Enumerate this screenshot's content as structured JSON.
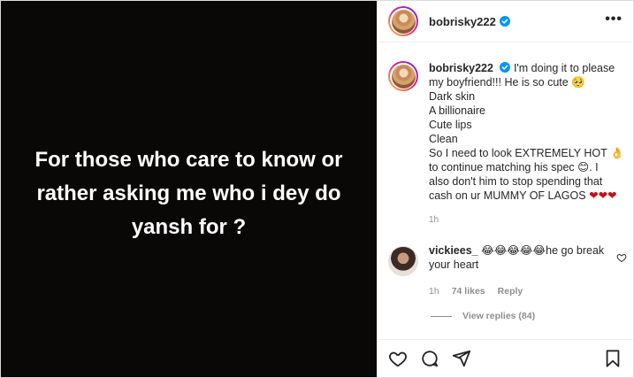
{
  "media": {
    "text": "For those who care to know or rather asking me who i dey do yansh for ?"
  },
  "header": {
    "username": "bobrisky222"
  },
  "caption": {
    "username": "bobrisky222",
    "lines": [
      "I'm doing it to please",
      "my boyfriend!!! He is so cute 🥺",
      "Dark skin",
      "A billionaire",
      "Cute lips",
      "Clean",
      "So I need to look EXTREMELY HOT 👌",
      "to continue matching his spec 😊. I",
      "also don't him to stop spending that",
      "cash on ur MUMMY OF LAGOS"
    ],
    "hearts": "❤❤❤",
    "time": "1h"
  },
  "comment": {
    "username": "vickiees_",
    "emojis": "😂😂😂😂😂",
    "text": "he go break your heart",
    "time": "1h",
    "likes": "74 likes",
    "reply": "Reply"
  },
  "view_replies": "View replies (84)",
  "icons": {
    "verified": "verified-badge-icon",
    "more": "more-options-icon",
    "like": "heart-icon",
    "comment": "comment-icon",
    "share": "share-icon",
    "save": "bookmark-icon"
  },
  "colors": {
    "accent": "#0095f6",
    "media_bg": "#0a0707",
    "hearts": "#c0121a"
  }
}
